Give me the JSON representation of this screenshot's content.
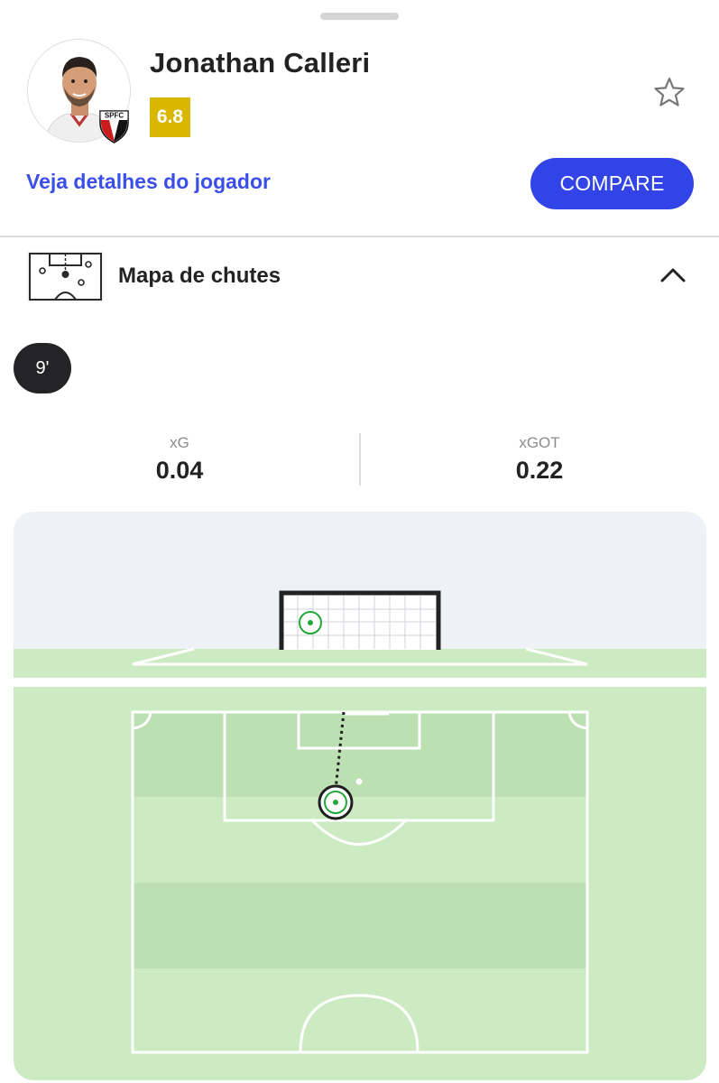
{
  "player": {
    "name": "Jonathan Calleri",
    "rating": "6.8",
    "club_badge_text": "SPFC",
    "details_link": "Veja detalhes do jogador",
    "compare_label": "COMPARE"
  },
  "section": {
    "title": "Mapa de chutes"
  },
  "shot": {
    "minute": "9'",
    "stats": [
      {
        "label": "xG",
        "value": "0.04"
      },
      {
        "label": "xGOT",
        "value": "0.22"
      }
    ]
  },
  "colors": {
    "accent": "#3244e8",
    "rating": "#d9b600",
    "pitch_light": "#cdebc2",
    "pitch_dark": "#bde0b3",
    "marker_green": "#22a83a"
  },
  "icons": [
    "star-icon",
    "shot-map-icon",
    "chevron-up-icon"
  ]
}
